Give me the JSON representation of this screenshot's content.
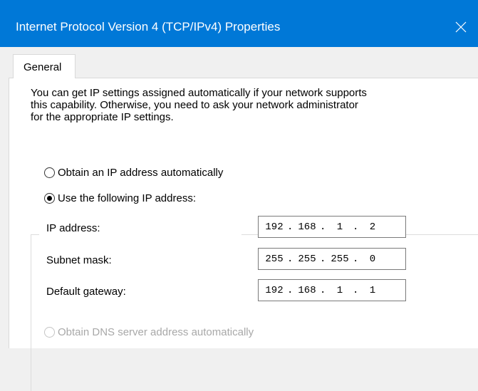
{
  "window": {
    "title": "Internet Protocol Version 4 (TCP/IPv4) Properties",
    "accent_color": "#0078d7",
    "close_icon": "close-icon"
  },
  "tabs": [
    {
      "label": "General",
      "selected": true
    }
  ],
  "general": {
    "description_lines": [
      "You can get IP settings assigned automatically if your network supports",
      "this capability. Otherwise, you need to ask your network administrator",
      "for the appropriate IP settings."
    ],
    "ip_auto_label": "Obtain an IP address automatically",
    "ip_auto_selected": false,
    "ip_manual_label": "Use the following IP address:",
    "ip_manual_selected": true,
    "fields": {
      "ip_address": {
        "label": "IP address:",
        "octets": [
          "192",
          "168",
          "1",
          "2"
        ]
      },
      "subnet_mask": {
        "label": "Subnet mask:",
        "octets": [
          "255",
          "255",
          "255",
          "0"
        ]
      },
      "default_gateway": {
        "label": "Default gateway:",
        "octets": [
          "192",
          "168",
          "1",
          "1"
        ]
      }
    },
    "dns_auto_label": "Obtain DNS server address automatically",
    "dns_auto_selected": false,
    "dns_auto_enabled": false
  }
}
